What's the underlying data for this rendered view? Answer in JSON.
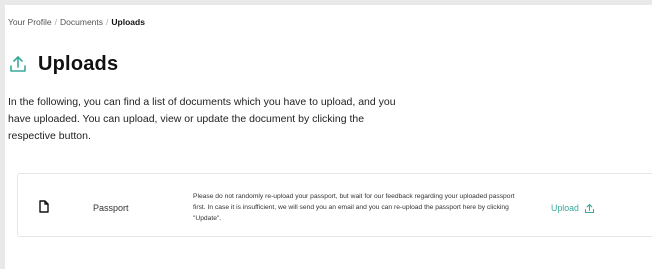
{
  "breadcrumb": {
    "items": [
      "Your Profile",
      "Documents"
    ],
    "current": "Uploads",
    "separator": "/"
  },
  "page": {
    "title": "Uploads",
    "title_icon": "upload-icon",
    "intro": "In the following, you can find a list of documents which you have to upload, and you have uploaded. You can upload, view or update the document by clicking the respective button."
  },
  "documents": [
    {
      "icon": "document-icon",
      "name": "Passport",
      "note": "Please do not randomly re-upload your passport, but wait for our feedback regarding your uploaded passport first. In case it is insufficient, we will send you an email and you can re-upload the passport here by clicking \"Update\".",
      "action_label": "Upload",
      "action_icon": "upload-icon"
    }
  ],
  "colors": {
    "accent": "#3aa89a",
    "background": "#e9e9e9"
  }
}
